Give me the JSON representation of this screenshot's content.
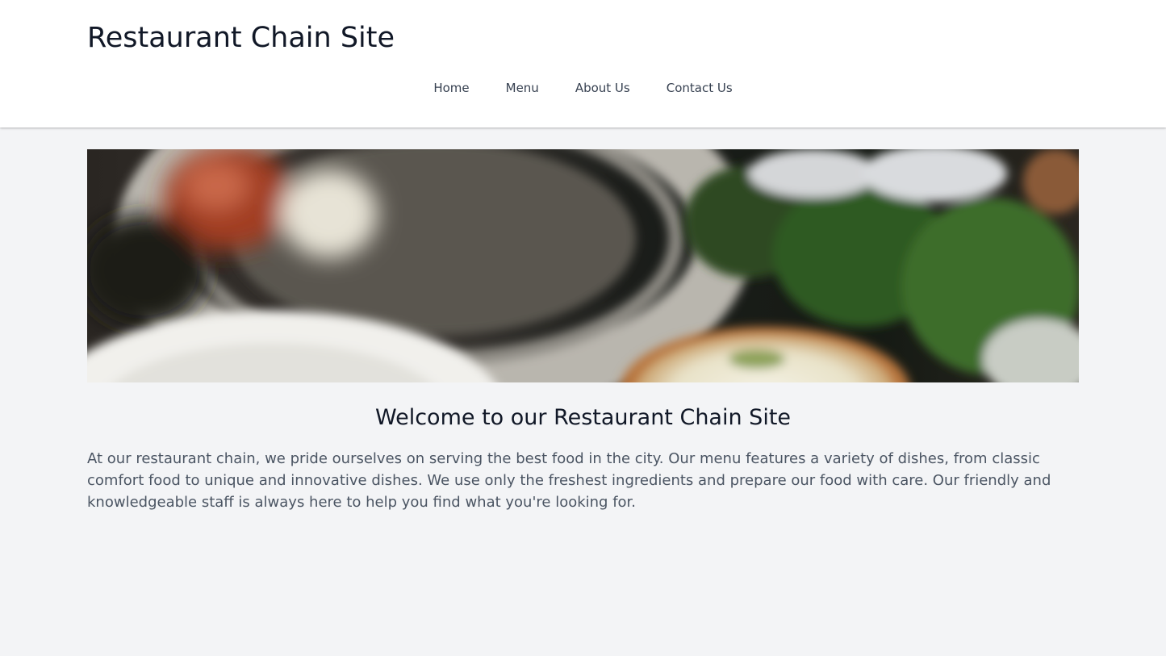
{
  "site": {
    "title": "Restaurant Chain Site"
  },
  "nav": {
    "items": [
      "Home",
      "Menu",
      "About Us",
      "Contact Us"
    ]
  },
  "hero": {
    "image": "blurred-food-plates-photo"
  },
  "main": {
    "heading": "Welcome to our Restaurant Chain Site",
    "paragraph": "At our restaurant chain, we pride ourselves on serving the best food in the city. Our menu features a variety of dishes, from classic comfort food to unique and innovative dishes. We use only the freshest ingredients and prepare our food with care. Our friendly and knowledgeable staff is always here to help you find what you're looking for."
  },
  "colors": {
    "page_background": "#f3f4f6",
    "header_background": "#ffffff",
    "title_text": "#111827",
    "nav_text": "#374151",
    "body_text": "#4b5563"
  }
}
